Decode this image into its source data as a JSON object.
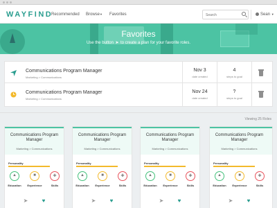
{
  "nav": {
    "logo": "WAYFIND",
    "links": [
      "Recommended",
      "Browse",
      "Favorites"
    ],
    "search_placeholder": "Search",
    "user": "Sean"
  },
  "hero": {
    "title": "Favorites",
    "subtitle_before": "Use the button",
    "subtitle_after": "to create a plan for your favorite roles."
  },
  "favorites": [
    {
      "title": "Communications Program Manager",
      "path": "Marketing > Communications",
      "date": "Nov 3",
      "date_label": "date created",
      "steps": "4",
      "steps_label": "steps to goal",
      "status": "planned"
    },
    {
      "title": "Communications Program Manager",
      "path": "Marketing > Communications",
      "date": "Nov 24",
      "date_label": "date created",
      "steps": "?",
      "steps_label": "steps to goal",
      "status": "pending"
    }
  ],
  "viewing": "Viewing 25 Roles",
  "cards": [
    {
      "title": "Communications Program Manager",
      "path": "Marketing > Communications",
      "personality": "Personality",
      "education": "Education",
      "experience": "Experience",
      "skills": "Skills"
    },
    {
      "title": "Communications Program Manager",
      "path": "Marketing > Communications",
      "personality": "Personality",
      "education": "Education",
      "experience": "Experience",
      "skills": "Skills"
    },
    {
      "title": "Communications Program Manager",
      "path": "Marketing > Communications",
      "personality": "Personality",
      "education": "Education",
      "experience": "Experience",
      "skills": "Skills"
    },
    {
      "title": "Communications Program Manager",
      "path": "Marketing > Communications",
      "personality": "Personality",
      "education": "Education",
      "experience": "Experience",
      "skills": "Skills"
    }
  ],
  "icons": {
    "plan": "paper-plane-icon",
    "pending": "clock-icon",
    "delete": "trash-icon",
    "favorite": "heart-icon",
    "education": "graduation-cap-icon",
    "experience": "briefcase-icon",
    "skills": "tool-icon"
  },
  "colors": {
    "brand": "#2a9d8f",
    "hero": "#4cc3a3",
    "education": "#43c07a",
    "experience": "#f3b92b",
    "skills": "#e8525b",
    "pending": "#f3b92b"
  }
}
